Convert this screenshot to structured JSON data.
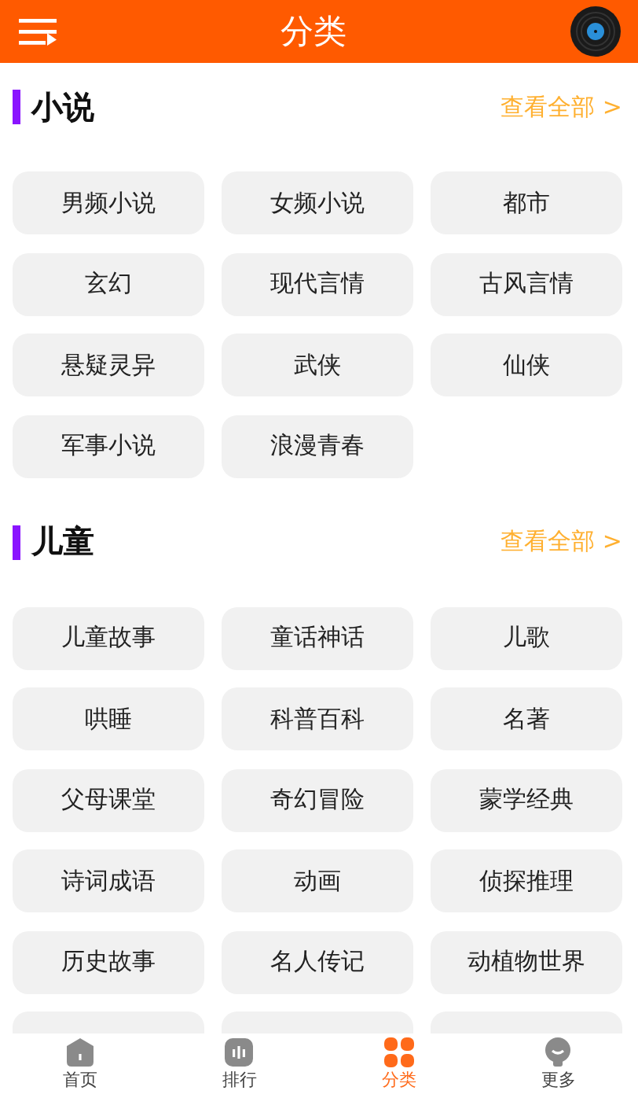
{
  "header": {
    "title": "分类"
  },
  "sections": [
    {
      "title": "小说",
      "link": "查看全部 >",
      "items": [
        {
          "label": "男频小说"
        },
        {
          "label": "女频小说"
        },
        {
          "label": "都市"
        },
        {
          "label": "玄幻"
        },
        {
          "label": "现代言情"
        },
        {
          "label": "古风言情"
        },
        {
          "label": "悬疑灵异"
        },
        {
          "label": "武侠"
        },
        {
          "label": "仙侠"
        },
        {
          "label": "军事小说"
        },
        {
          "label": "浪漫青春"
        }
      ]
    },
    {
      "title": "儿童",
      "link": "查看全部 >",
      "items": [
        {
          "label": "儿童故事"
        },
        {
          "label": "童话神话"
        },
        {
          "label": "儿歌"
        },
        {
          "label": "哄睡"
        },
        {
          "label": "科普百科"
        },
        {
          "label": "名著"
        },
        {
          "label": "父母课堂"
        },
        {
          "label": "奇幻冒险"
        },
        {
          "label": "蒙学经典"
        },
        {
          "label": "诗词成语"
        },
        {
          "label": "动画"
        },
        {
          "label": "侦探推理"
        },
        {
          "label": "历史故事"
        },
        {
          "label": "名人传记"
        },
        {
          "label": "动植物世界"
        },
        {
          "kind": "cut"
        },
        {
          "kind": "cut"
        },
        {
          "kind": "cut"
        }
      ]
    }
  ],
  "nav": [
    {
      "label": "首页",
      "selected": false
    },
    {
      "label": "排行",
      "selected": false
    },
    {
      "label": "分类",
      "selected": true
    },
    {
      "label": "更多",
      "selected": false
    }
  ]
}
